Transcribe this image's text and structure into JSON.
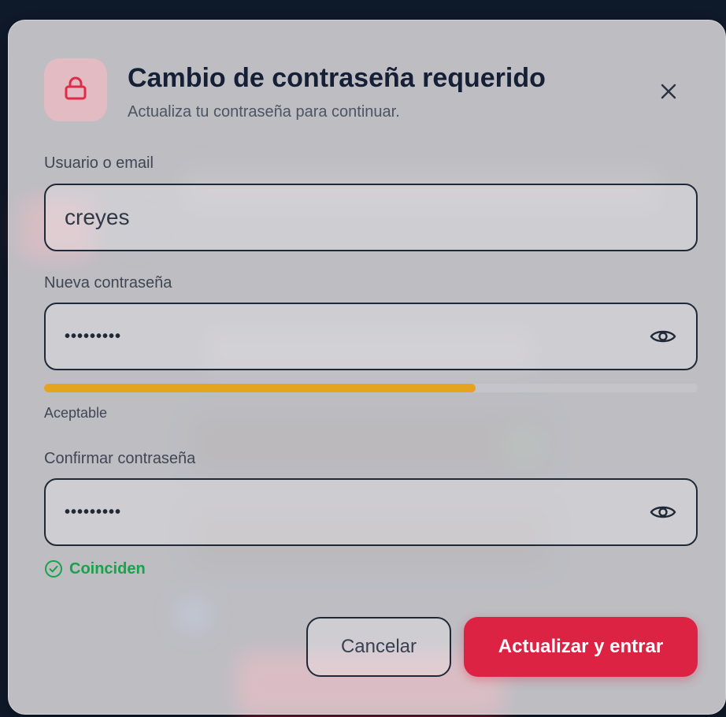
{
  "dialog": {
    "title": "Cambio de contraseña requerido",
    "subtitle": "Actualiza tu contraseña para continuar.",
    "icon": "lock-icon",
    "close_icon": "close-icon"
  },
  "form": {
    "username": {
      "label": "Usuario o email",
      "value": "creyes"
    },
    "new_password": {
      "label": "Nueva contraseña",
      "value": "•••••••••",
      "toggle_icon": "eye-icon"
    },
    "strength": {
      "level": 0.66,
      "text": "Aceptable",
      "color": "#e4a41d"
    },
    "confirm_password": {
      "label": "Confirmar contraseña",
      "value": "•••••••••",
      "toggle_icon": "eye-icon"
    },
    "match": {
      "text": "Coinciden",
      "icon": "check-circle-icon",
      "color": "#17a34a"
    }
  },
  "actions": {
    "cancel_label": "Cancelar",
    "submit_label": "Actualizar y entrar"
  },
  "colors": {
    "accent": "#dc2343",
    "background": "#0f1a2b"
  }
}
